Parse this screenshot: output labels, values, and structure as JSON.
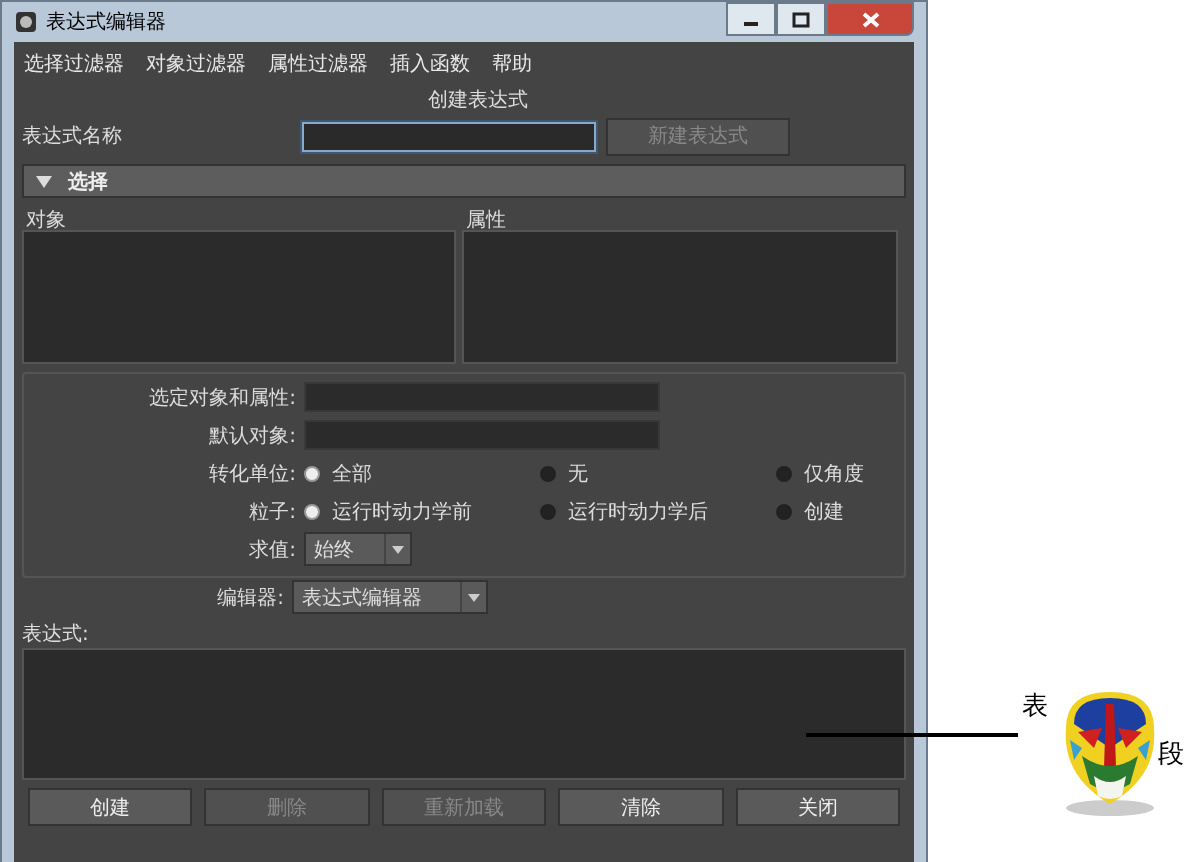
{
  "window": {
    "title": "表达式编辑器",
    "controls": [
      {
        "kind": "minimize"
      },
      {
        "kind": "maximize"
      },
      {
        "kind": "close"
      }
    ]
  },
  "menu": [
    "选择过滤器",
    "对象过滤器",
    "属性过滤器",
    "插入函数",
    "帮助"
  ],
  "heading": "创建表达式",
  "name_field": {
    "label": "表达式名称",
    "focused": true
  },
  "new_button": {
    "label": "新建表达式",
    "disabled": true
  },
  "section": {
    "title": "选择",
    "expanded": true
  },
  "lists": [
    {
      "heading": "对象"
    },
    {
      "heading": "属性"
    }
  ],
  "fields": [
    {
      "label": "选定对象和属性:"
    },
    {
      "label": "默认对象:"
    }
  ],
  "radio_groups": [
    {
      "label": "转化单位:",
      "options": [
        {
          "label": "全部",
          "selected": true
        },
        {
          "label": "无",
          "selected": false
        },
        {
          "label": "仅角度",
          "selected": false
        }
      ]
    },
    {
      "label": "粒子:",
      "options": [
        {
          "label": "运行时动力学前",
          "selected": true
        },
        {
          "label": "运行时动力学后",
          "selected": false
        },
        {
          "label": "创建",
          "selected": false
        }
      ]
    }
  ],
  "evaluation": {
    "label": "求值:",
    "value": "始终"
  },
  "editor": {
    "label": "编辑器:",
    "value": "表达式编辑器"
  },
  "expression": {
    "label": "表达式:"
  },
  "buttons": [
    {
      "label": "创建",
      "disabled": false
    },
    {
      "label": "删除",
      "disabled": true
    },
    {
      "label": "重新加载",
      "disabled": true
    },
    {
      "label": "清除",
      "disabled": false
    },
    {
      "label": "关闭",
      "disabled": false
    }
  ],
  "annotation": {
    "texts": [
      "表",
      "段"
    ]
  }
}
